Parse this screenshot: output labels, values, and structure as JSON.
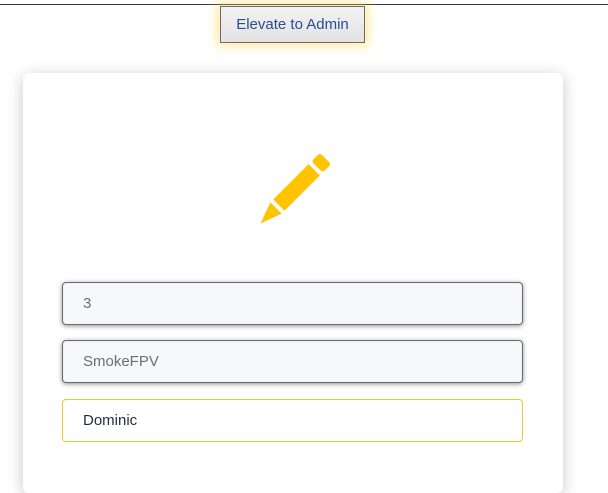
{
  "header": {
    "elevate_button_label": "Elevate to Admin"
  },
  "form": {
    "icon": "pencil-icon",
    "fields": [
      {
        "name": "id",
        "value": "3"
      },
      {
        "name": "username",
        "value": "SmokeFPV"
      },
      {
        "name": "first_name",
        "value": "Dominic"
      }
    ]
  },
  "colors": {
    "accent": "#FFC400",
    "focus_border": "#F3C531",
    "button_text": "#2A4D8F"
  }
}
